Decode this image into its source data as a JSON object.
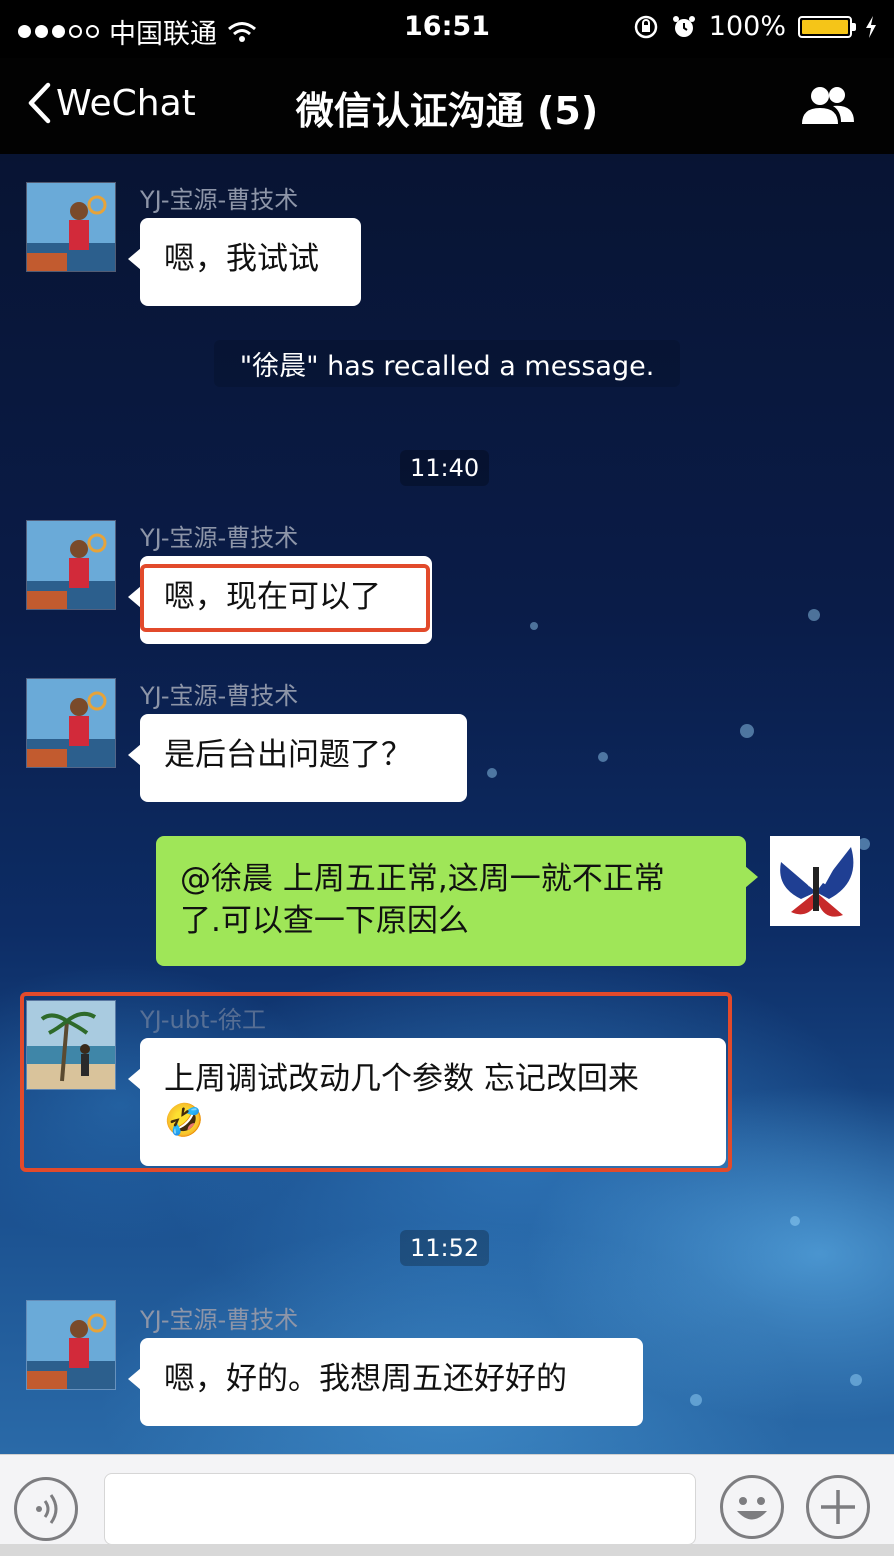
{
  "status_bar": {
    "carrier": "中国联通",
    "time": "16:51",
    "battery": "100%",
    "battery_level": 1.0
  },
  "nav": {
    "back_label": "WeChat",
    "title": "微信认证沟通 (5)"
  },
  "messages": [
    {
      "sender": "YJ-宝源-曹技术",
      "text": "嗯，我试试"
    },
    {
      "system": "\"徐晨\" has recalled a message."
    },
    {
      "timestamp": "11:40"
    },
    {
      "sender": "YJ-宝源-曹技术",
      "text": "嗯，现在可以了"
    },
    {
      "sender": "YJ-宝源-曹技术",
      "text": "是后台出问题了？"
    },
    {
      "text_line1": "@徐晨 上周五正常,这周一就不正常",
      "text_line2": "了.可以查一下原因么"
    },
    {
      "sender": "YJ-ubt-徐工",
      "text": "上周调试改动几个参数 忘记改回来",
      "emoji": "🤣"
    },
    {
      "timestamp": "11:52"
    },
    {
      "sender": "YJ-宝源-曹技术",
      "text": "嗯，好的。我想周五还好好的"
    }
  ],
  "input": {
    "placeholder": ""
  },
  "colors": {
    "highlight": "#e24a2b",
    "own_bubble": "#9fe658",
    "nav_bg": "#020202"
  },
  "icons": [
    "wifi-icon",
    "lock-rotation-icon",
    "alarm-icon",
    "battery-icon",
    "charging-icon",
    "back-chevron-icon",
    "group-members-icon",
    "voice-icon",
    "emoji-icon",
    "plus-icon"
  ]
}
